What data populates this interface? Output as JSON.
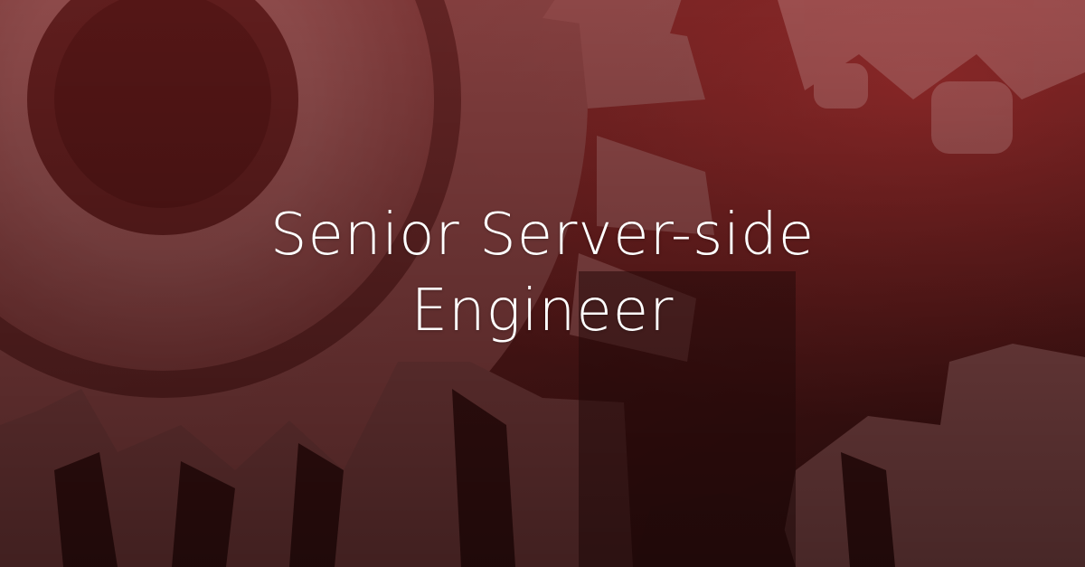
{
  "banner": {
    "title_line_1": "Senior Server-side",
    "title_line_2": "Engineer",
    "background_image": "industrial-gears-photo",
    "overlay_colors": {
      "top_left": "#7a2c2c",
      "right": "#7a1212",
      "bottom_left": "#2a0c0c"
    },
    "text_color": "#ffffff"
  }
}
